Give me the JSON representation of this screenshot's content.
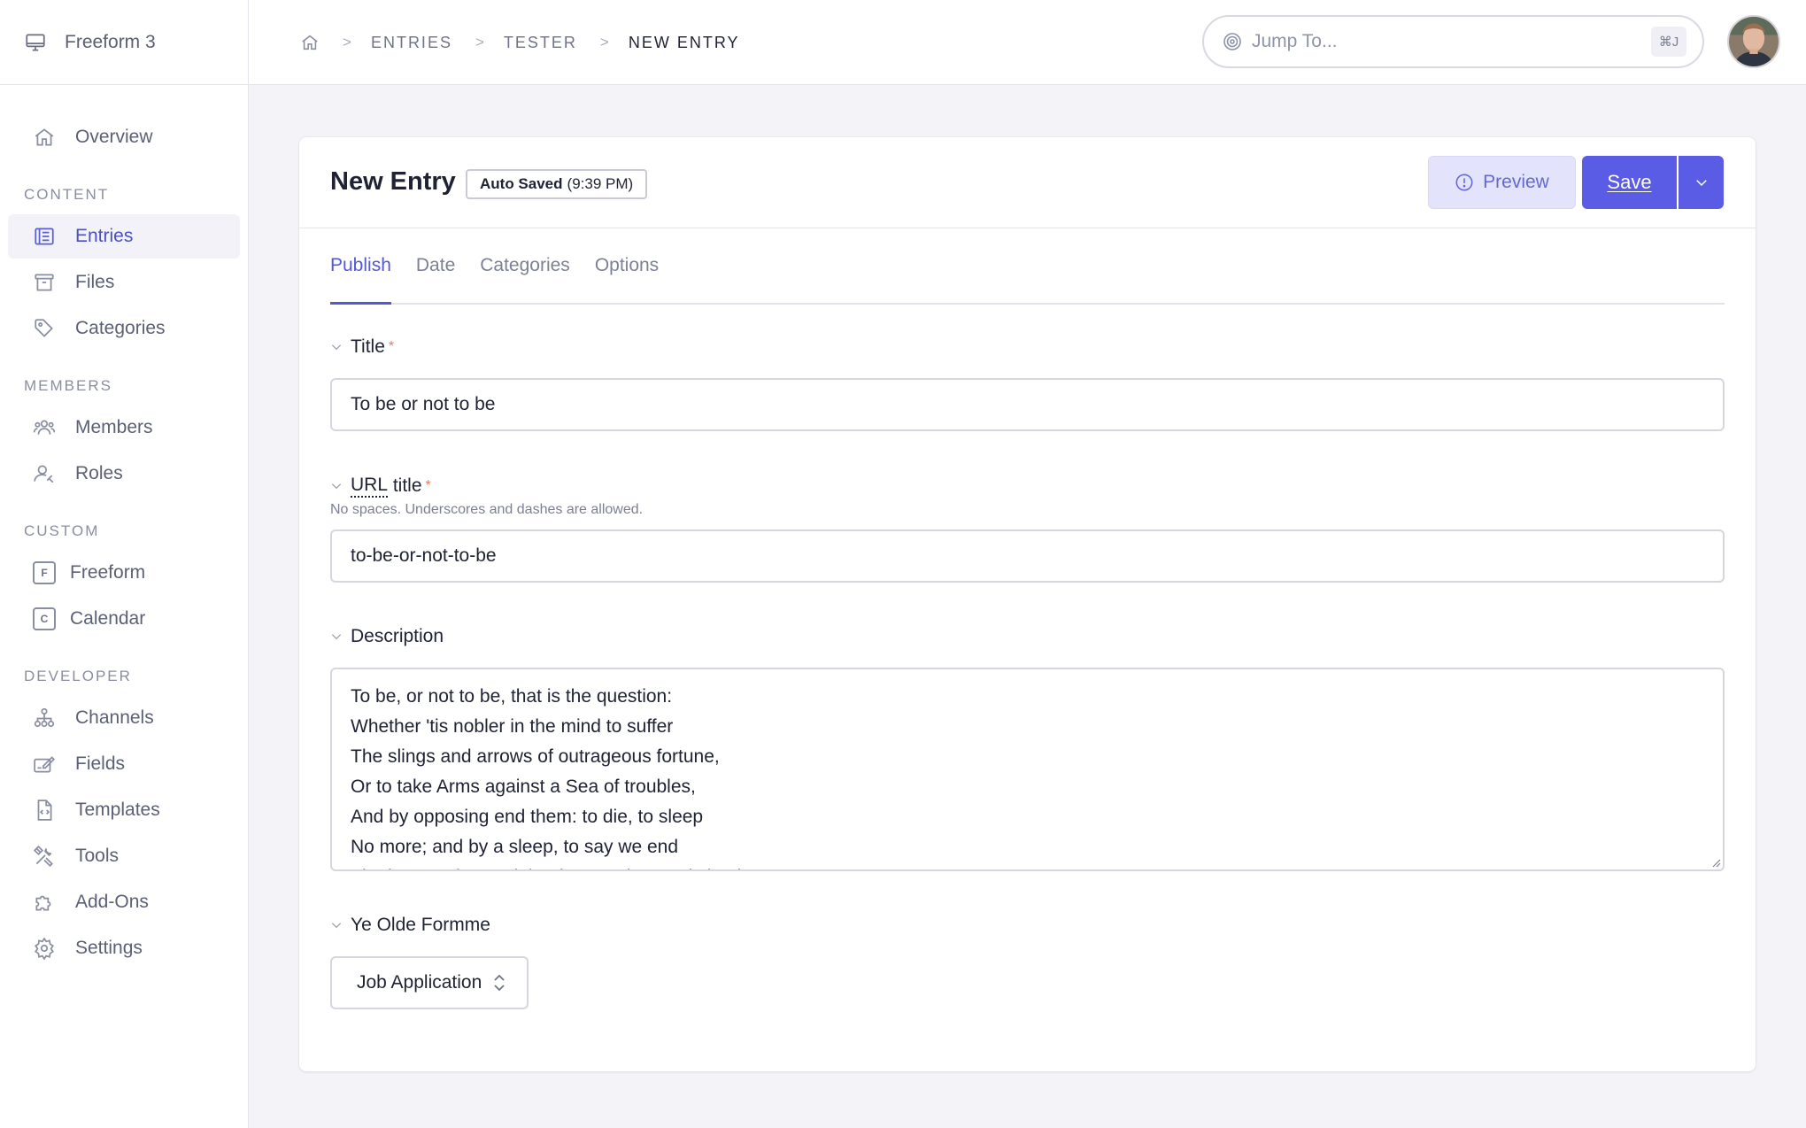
{
  "brand": {
    "name": "Freeform 3",
    "icon": "monitor-icon"
  },
  "sidebar": {
    "overview": {
      "label": "Overview",
      "icon": "home-icon"
    },
    "sections": {
      "content": "CONTENT",
      "members": "MEMBERS",
      "custom": "CUSTOM",
      "developer": "DEVELOPER"
    },
    "content_items": [
      {
        "label": "Entries",
        "icon": "entries-icon",
        "active": true
      },
      {
        "label": "Files",
        "icon": "archive-icon"
      },
      {
        "label": "Categories",
        "icon": "tag-icon"
      }
    ],
    "member_items": [
      {
        "label": "Members",
        "icon": "users-icon"
      },
      {
        "label": "Roles",
        "icon": "user-role-icon"
      }
    ],
    "custom_items": [
      {
        "label": "Freeform",
        "letter": "F"
      },
      {
        "label": "Calendar",
        "letter": "C"
      }
    ],
    "developer_items": [
      {
        "label": "Channels",
        "icon": "sitemap-icon"
      },
      {
        "label": "Fields",
        "icon": "edit-fields-icon"
      },
      {
        "label": "Templates",
        "icon": "file-code-icon"
      },
      {
        "label": "Tools",
        "icon": "tools-icon"
      },
      {
        "label": "Add-Ons",
        "icon": "puzzle-icon"
      },
      {
        "label": "Settings",
        "icon": "gear-icon"
      }
    ]
  },
  "breadcrumb": {
    "items": [
      "ENTRIES",
      "TESTER"
    ],
    "separator": ">",
    "current": "NEW ENTRY"
  },
  "jump": {
    "placeholder": "Jump To...",
    "shortcut": "⌘J"
  },
  "entry": {
    "title": "New Entry",
    "autosave_label": "Auto Saved",
    "autosave_time": "(9:39 PM)",
    "preview_label": "Preview",
    "save_label": "Save"
  },
  "tabs": [
    {
      "label": "Publish",
      "active": true
    },
    {
      "label": "Date"
    },
    {
      "label": "Categories"
    },
    {
      "label": "Options"
    }
  ],
  "fields": {
    "title": {
      "label": "Title",
      "required": "*",
      "value": "To be or not to be"
    },
    "url_title": {
      "label": "URL title",
      "label_abbr": "URL",
      "label_rest": " title",
      "required": "*",
      "hint": "No spaces. Underscores and dashes are allowed.",
      "value": "to-be-or-not-to-be"
    },
    "description": {
      "label": "Description",
      "lines": [
        "To be, or not to be, that is the question:",
        "Whether 'tis nobler in the mind to suffer",
        "The slings and arrows of outrageous fortune,",
        "Or to take Arms against a Sea of troubles,",
        "And by opposing end them: to die, to sleep",
        "No more; and by a sleep, to say we end",
        "The heart-ache, and the thousand natural shocks"
      ]
    },
    "form": {
      "label": "Ye Olde Formme",
      "selected": "Job Application"
    }
  },
  "colors": {
    "accent": "#5b5ce6",
    "accent_text": "#5558d6",
    "preview_bg": "#e3e4fb",
    "required": "#e07e6a",
    "page_bg": "#f3f3f8"
  }
}
